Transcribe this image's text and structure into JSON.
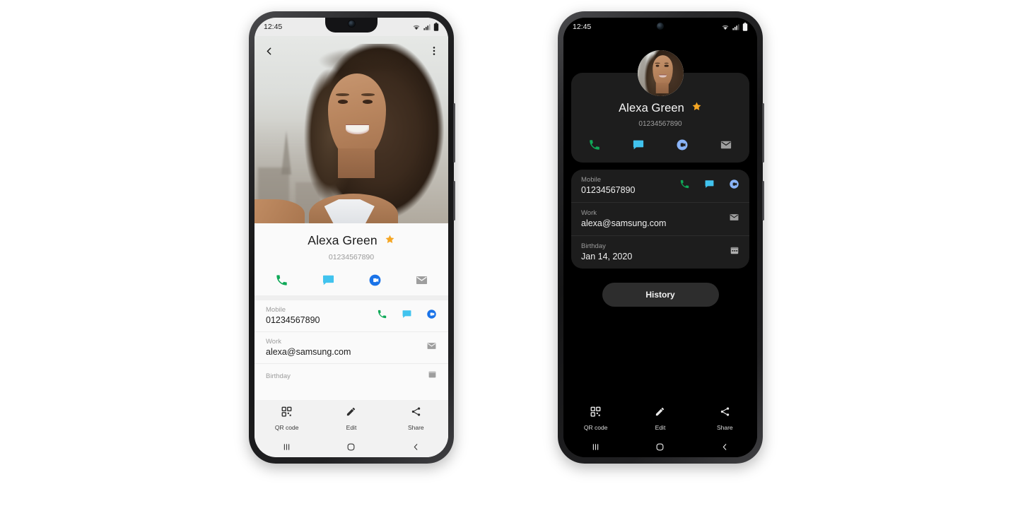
{
  "phones": [
    {
      "id": "light-phone",
      "theme": "light",
      "status": {
        "time": "12:45",
        "wifi": "wifi-icon",
        "signal": "signal-icon",
        "battery": "battery-icon"
      },
      "topbar": {
        "back": "back-arrow-icon",
        "more": "more-options-icon"
      },
      "contact": {
        "name": "Alexa Green",
        "phone": "01234567890",
        "favorite": true,
        "favorite_icon": "star-icon"
      },
      "actions": [
        {
          "name": "call",
          "icon": "phone-icon",
          "color": "#0fa958"
        },
        {
          "name": "message",
          "icon": "message-icon",
          "color": "#41c3ee"
        },
        {
          "name": "video-call",
          "icon": "duo-video-icon",
          "color": "#1a73e8"
        },
        {
          "name": "email",
          "icon": "email-icon",
          "color": "#9e9e9e"
        }
      ],
      "details": [
        {
          "label": "Mobile",
          "value": "01234567890",
          "icons": [
            "phone-icon",
            "message-icon",
            "duo-video-icon"
          ]
        },
        {
          "label": "Work",
          "value": "alexa@samsung.com",
          "icons": [
            "email-icon"
          ]
        },
        {
          "label": "Birthday",
          "value": "",
          "icons": [
            "calendar-icon"
          ]
        }
      ],
      "bottombar": [
        {
          "label": "QR code",
          "icon": "qr-code-icon"
        },
        {
          "label": "Edit",
          "icon": "pencil-icon"
        },
        {
          "label": "Share",
          "icon": "share-icon"
        }
      ],
      "navbar": [
        {
          "name": "recents",
          "icon": "recents-icon"
        },
        {
          "name": "home",
          "icon": "home-icon"
        },
        {
          "name": "back",
          "icon": "back-icon"
        }
      ]
    },
    {
      "id": "dark-phone",
      "theme": "dark",
      "status": {
        "time": "12:45",
        "wifi": "wifi-icon",
        "signal": "signal-icon",
        "battery": "battery-icon"
      },
      "contact": {
        "name": "Alexa Green",
        "phone": "01234567890",
        "favorite": true,
        "favorite_icon": "star-icon",
        "avatar": "contact-avatar"
      },
      "actions": [
        {
          "name": "call",
          "icon": "phone-icon",
          "color": "#0fa958"
        },
        {
          "name": "message",
          "icon": "message-icon",
          "color": "#41c3ee"
        },
        {
          "name": "video-call",
          "icon": "duo-video-icon",
          "color": "#8ab4f8"
        },
        {
          "name": "email",
          "icon": "email-icon",
          "color": "#9e9e9e"
        }
      ],
      "details": [
        {
          "label": "Mobile",
          "value": "01234567890",
          "icons": [
            "phone-icon",
            "message-icon",
            "duo-video-icon"
          ]
        },
        {
          "label": "Work",
          "value": "alexa@samsung.com",
          "icons": [
            "email-icon"
          ]
        },
        {
          "label": "Birthday",
          "value": "Jan 14, 2020",
          "icons": [
            "calendar-icon"
          ]
        }
      ],
      "history_button": "History",
      "bottombar": [
        {
          "label": "QR code",
          "icon": "qr-code-icon"
        },
        {
          "label": "Edit",
          "icon": "pencil-icon"
        },
        {
          "label": "Share",
          "icon": "share-icon"
        }
      ],
      "navbar": [
        {
          "name": "recents",
          "icon": "recents-icon"
        },
        {
          "name": "home",
          "icon": "home-icon"
        },
        {
          "name": "back",
          "icon": "back-icon"
        }
      ]
    }
  ],
  "colors": {
    "star": "#f5a623",
    "call_green": "#0fa958",
    "message_blue": "#41c3ee",
    "duo_blue": "#1a73e8",
    "duo_blue_dark": "#8ab4f8",
    "email_gray": "#9e9e9e",
    "card_dark": "#1d1d1d",
    "history_btn": "#2d2d2d"
  }
}
